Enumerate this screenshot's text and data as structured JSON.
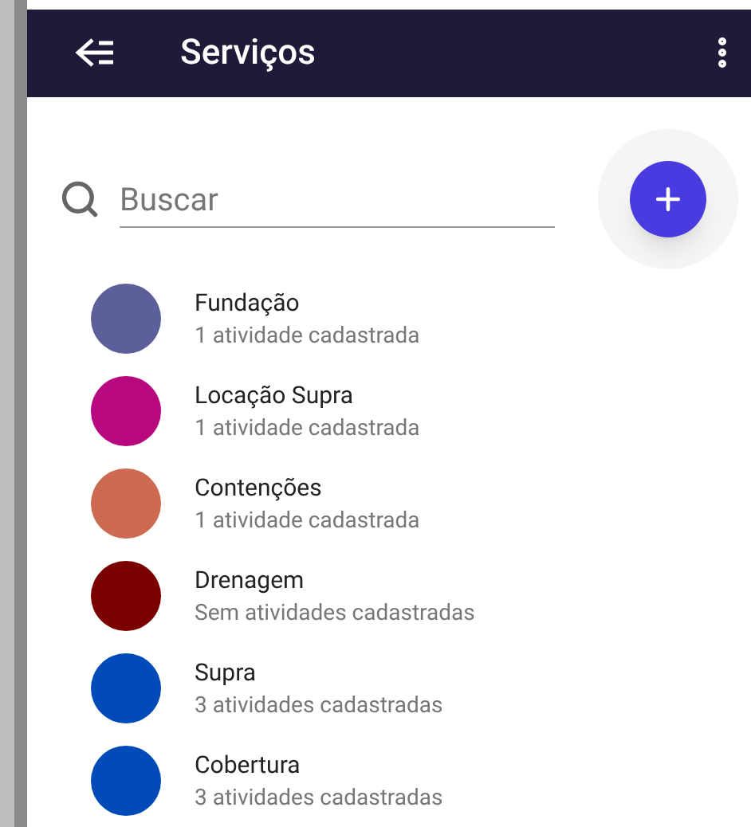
{
  "header": {
    "title": "Serviços"
  },
  "search": {
    "placeholder": "Buscar"
  },
  "services": [
    {
      "name": "Fundação",
      "subtitle": "1 atividade cadastrada",
      "color": "#5c5f99"
    },
    {
      "name": "Locação Supra",
      "subtitle": "1 atividade cadastrada",
      "color": "#b8087f"
    },
    {
      "name": "Contenções",
      "subtitle": "1 atividade cadastrada",
      "color": "#cc6b52"
    },
    {
      "name": "Drenagem",
      "subtitle": "Sem atividades cadastradas",
      "color": "#7a0000"
    },
    {
      "name": "Supra",
      "subtitle": "3 atividades cadastradas",
      "color": "#004bb8"
    },
    {
      "name": "Cobertura",
      "subtitle": "3 atividades cadastradas",
      "color": "#004bb8"
    }
  ]
}
